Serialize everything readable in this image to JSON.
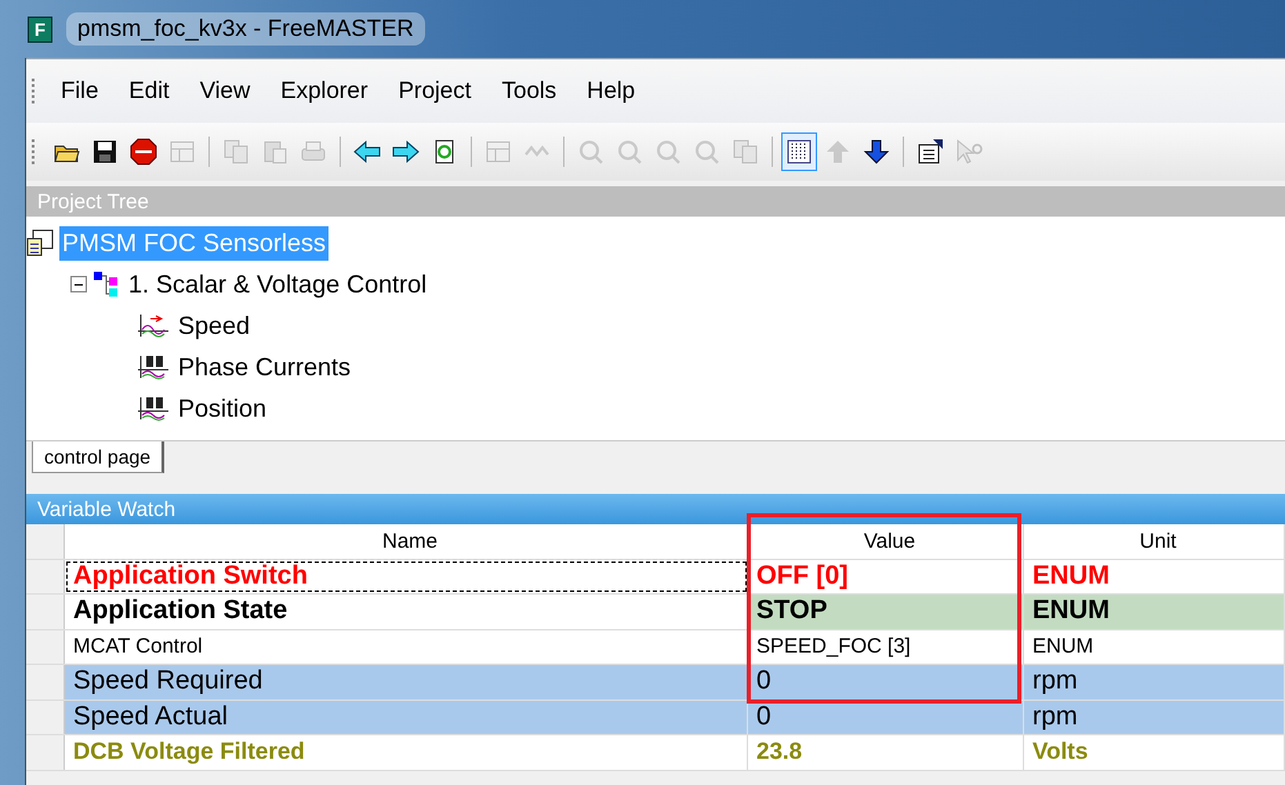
{
  "window": {
    "title": "pmsm_foc_kv3x - FreeMASTER",
    "app_letter": "F"
  },
  "menu": [
    "File",
    "Edit",
    "View",
    "Explorer",
    "Project",
    "Tools",
    "Help"
  ],
  "toolbar": [
    {
      "kind": "folder",
      "disabled": false,
      "selected": false
    },
    {
      "kind": "save",
      "disabled": false,
      "selected": false
    },
    {
      "kind": "stop",
      "disabled": false,
      "selected": false
    },
    {
      "kind": "panel",
      "disabled": true,
      "selected": false
    },
    {
      "kind": "sep"
    },
    {
      "kind": "copy",
      "disabled": true,
      "selected": false
    },
    {
      "kind": "paste",
      "disabled": true,
      "selected": false
    },
    {
      "kind": "print",
      "disabled": true,
      "selected": false
    },
    {
      "kind": "sep"
    },
    {
      "kind": "left",
      "disabled": false,
      "selected": false
    },
    {
      "kind": "right",
      "disabled": false,
      "selected": false
    },
    {
      "kind": "refresh",
      "disabled": false,
      "selected": false
    },
    {
      "kind": "sep"
    },
    {
      "kind": "panel",
      "disabled": true,
      "selected": false
    },
    {
      "kind": "wave",
      "disabled": true,
      "selected": false
    },
    {
      "kind": "sep"
    },
    {
      "kind": "scope",
      "disabled": true,
      "selected": false
    },
    {
      "kind": "scope",
      "disabled": true,
      "selected": false
    },
    {
      "kind": "scope",
      "disabled": true,
      "selected": false
    },
    {
      "kind": "scope",
      "disabled": true,
      "selected": false
    },
    {
      "kind": "copy",
      "disabled": true,
      "selected": false
    },
    {
      "kind": "sep"
    },
    {
      "kind": "grid",
      "disabled": false,
      "selected": true
    },
    {
      "kind": "up",
      "disabled": true,
      "selected": false
    },
    {
      "kind": "down",
      "disabled": false,
      "selected": false
    },
    {
      "kind": "sep"
    },
    {
      "kind": "props",
      "disabled": false,
      "selected": false
    },
    {
      "kind": "help",
      "disabled": true,
      "selected": false
    }
  ],
  "project_tree": {
    "title": "Project Tree",
    "items": [
      {
        "label": "PMSM FOC Sensorless",
        "kind": "project",
        "selected": true,
        "children": [
          {
            "label": "1. Scalar & Voltage Control",
            "kind": "block",
            "selected": false,
            "expanded": true,
            "children": [
              {
                "label": "Speed",
                "kind": "recorder",
                "selected": false
              },
              {
                "label": "Phase Currents",
                "kind": "scope",
                "selected": false
              },
              {
                "label": "Position",
                "kind": "scope",
                "selected": false
              }
            ]
          }
        ]
      }
    ]
  },
  "tabs": [
    {
      "label": "control page",
      "selected": true
    }
  ],
  "variable_watch": {
    "title": "Variable Watch",
    "columns": [
      "Name",
      "Value",
      "Unit"
    ],
    "rows": [
      {
        "kind": "alert",
        "focused": true,
        "cells": [
          "Application Switch",
          "OFF [0]",
          "ENUM"
        ]
      },
      {
        "kind": "state",
        "focused": false,
        "cells": [
          "Application State",
          "STOP",
          "ENUM"
        ]
      },
      {
        "kind": "plain",
        "focused": false,
        "cells": [
          "MCAT Control",
          "SPEED_FOC [3]",
          "ENUM"
        ]
      },
      {
        "kind": "highlight",
        "focused": false,
        "cells": [
          "Speed Required",
          "0",
          "rpm"
        ]
      },
      {
        "kind": "highlight",
        "focused": false,
        "cells": [
          "Speed Actual",
          "0",
          "rpm"
        ]
      },
      {
        "kind": "olive",
        "focused": false,
        "cells": [
          "DCB Voltage Filtered",
          "23.8",
          "Volts"
        ]
      }
    ]
  }
}
